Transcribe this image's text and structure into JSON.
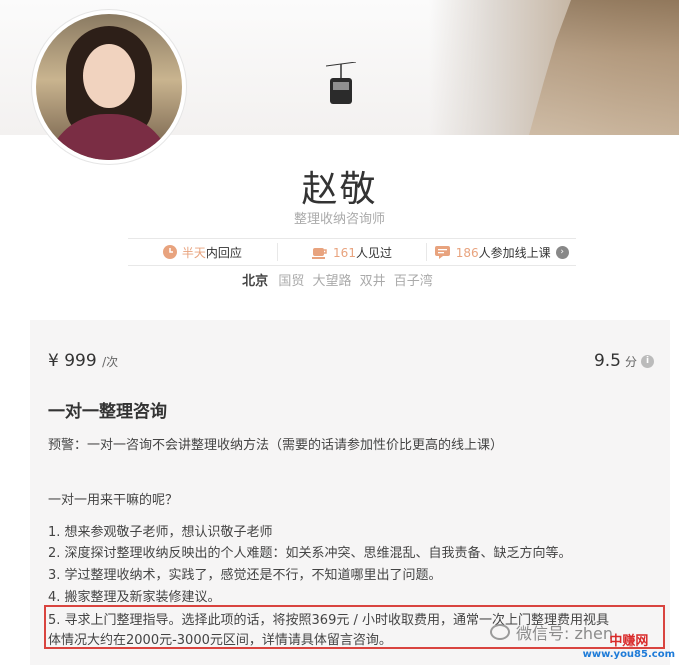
{
  "profile": {
    "name": "赵敬",
    "title": "整理收纳咨询师",
    "stats": [
      {
        "highlight": "半天",
        "text": "内回应",
        "icon": "clock-icon"
      },
      {
        "highlight": "161",
        "text": "人见过",
        "icon": "cup-icon"
      },
      {
        "highlight": "186",
        "text": "人参加线上课",
        "icon": "chat-icon"
      }
    ],
    "location": {
      "city": "北京",
      "districts": [
        "国贸",
        "大望路",
        "双井",
        "百子湾"
      ]
    }
  },
  "service": {
    "price": "¥ 999",
    "price_unit": "/次",
    "score": "9.5",
    "score_unit": "分",
    "name": "一对一整理咨询",
    "warning": "预警：一对一咨询不会讲整理收纳方法（需要的话请参加性价比更高的线上课）",
    "question": "一对一用来干嘛的呢？",
    "items": [
      "1. 想来参观敬子老师，想认识敬子老师",
      "2. 深度探讨整理收纳反映出的个人难题：如关系冲突、思维混乱、自我责备、缺乏方向等。",
      "3. 学过整理收纳术，实践了，感觉还是不行，不知道哪里出了问题。",
      "4. 搬家整理及新家装修建议。",
      "5. 寻求上门整理指导。选择此项的话，将按照369元 / 小时收取费用，通常一次上门整理费用视具",
      "体情况大约在2000元-3000元区间，详情请具体留言咨询。"
    ]
  },
  "watermark": {
    "text": "微信号: zhen",
    "site_name": "中赚网",
    "site_url": "www.you85.com"
  },
  "colors": {
    "accent": "#e8a37e",
    "highlight_border": "#d9443f",
    "card_bg": "#f6f5f5"
  }
}
